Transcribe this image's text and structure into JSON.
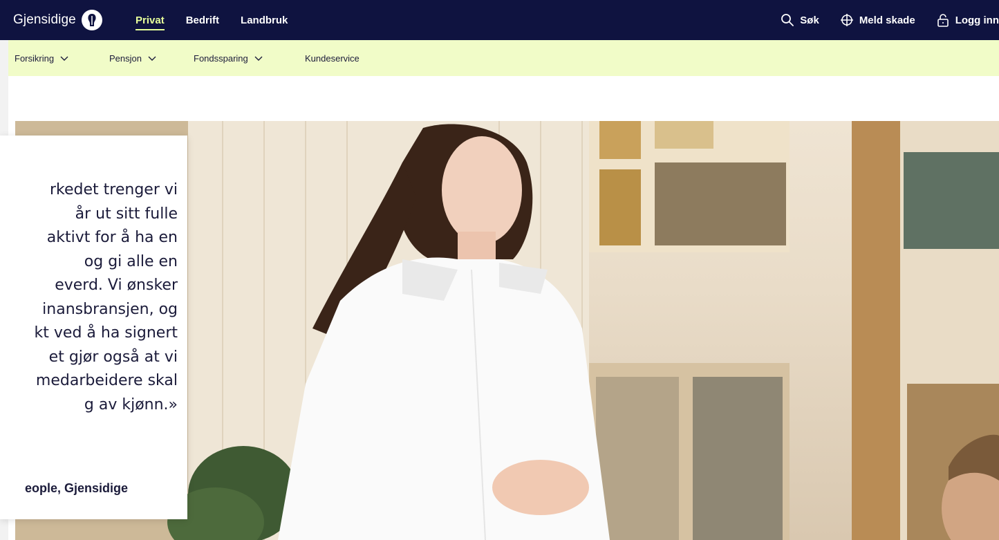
{
  "header": {
    "brand": "Gjensidige",
    "tabs": [
      {
        "label": "Privat",
        "active": true
      },
      {
        "label": "Bedrift",
        "active": false
      },
      {
        "label": "Landbruk",
        "active": false
      }
    ],
    "actions": [
      {
        "label": "Søk",
        "icon": "search-icon"
      },
      {
        "label": "Meld skade",
        "icon": "claim-cross-icon"
      },
      {
        "label": "Logg inn",
        "icon": "lock-icon"
      }
    ]
  },
  "subnav": {
    "items": [
      {
        "label": "Forsikring",
        "has_dropdown": true
      },
      {
        "label": "Pensjon",
        "has_dropdown": true
      },
      {
        "label": "Fondssparing",
        "has_dropdown": true
      },
      {
        "label": "Kundeservice",
        "has_dropdown": false
      }
    ]
  },
  "quote": {
    "lines": [
      "rkedet trenger vi",
      "år ut sitt fulle",
      "aktivt for å ha en",
      "og gi alle en",
      "everd. Vi ønsker",
      "inansbransjen, og",
      "kt ved å ha signert",
      "et gjør også at vi",
      "medarbeidere skal",
      "g av kjønn.»"
    ],
    "author": "eople, Gjensidige"
  },
  "colors": {
    "header_bg": "#0f1340",
    "subnav_bg": "#f1fcc8",
    "active_tab": "#e7ff9a",
    "text_dark": "#1b1b3a"
  }
}
